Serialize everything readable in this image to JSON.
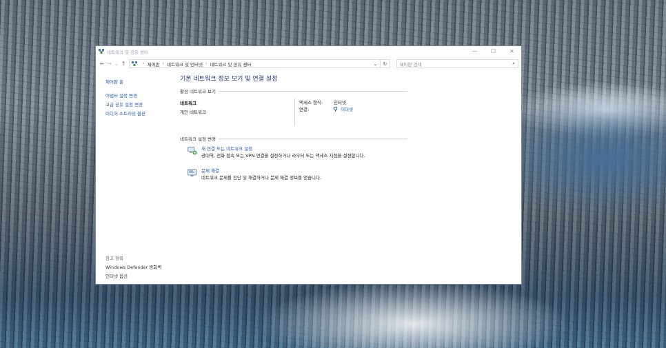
{
  "window": {
    "title": "네트워크 및 공유 센터",
    "controls": {
      "minimize": "—",
      "maximize": "☐",
      "close": "✕"
    }
  },
  "nav": {
    "back": "←",
    "forward": "→",
    "dropdown": "⌄",
    "up": "↑",
    "breadcrumb": [
      "제어판",
      "네트워크 및 인터넷",
      "네트워크 및 공유 센터"
    ],
    "breadcrumb_sep": "›",
    "address_dropdown": "⌄",
    "refresh": "↻",
    "search_placeholder": "제어판 검색",
    "search_icon": "⌕"
  },
  "sidebar": {
    "home": "제어판 홈",
    "links": [
      "어댑터 설정 변경",
      "고급 공유 설정 변경",
      "미디어 스트리밍 옵션"
    ],
    "see_also_title": "참고 항목",
    "see_also": [
      "Windows Defender 방화벽",
      "인터넷 옵션"
    ]
  },
  "main": {
    "heading": "기본 네트워크 정보 보기 및 연결 설정",
    "active_section": "활성 네트워크 보기",
    "network": {
      "name": "네트워크",
      "type": "개인 네트워크",
      "access_label": "액세스 형식:",
      "access_value": "인터넷",
      "connection_label": "연결:",
      "connection_value": "이더넷"
    },
    "change_section": "네트워크 설정 변경",
    "tasks": [
      {
        "title": "새 연결 또는 네트워크 설정",
        "desc": "광대역, 전화 접속 또는 VPN 연결을 설정하거나 라우터 또는 액세스 지점을 설정합니다.",
        "icon": "network-setup-icon"
      },
      {
        "title": "문제 해결",
        "desc": "네트워크 문제를 진단 및 해결하거나 문제 해결 정보를 얻습니다.",
        "icon": "troubleshoot-icon"
      }
    ]
  },
  "colors": {
    "link": "#1a5bb5",
    "heading": "#1e3287"
  }
}
